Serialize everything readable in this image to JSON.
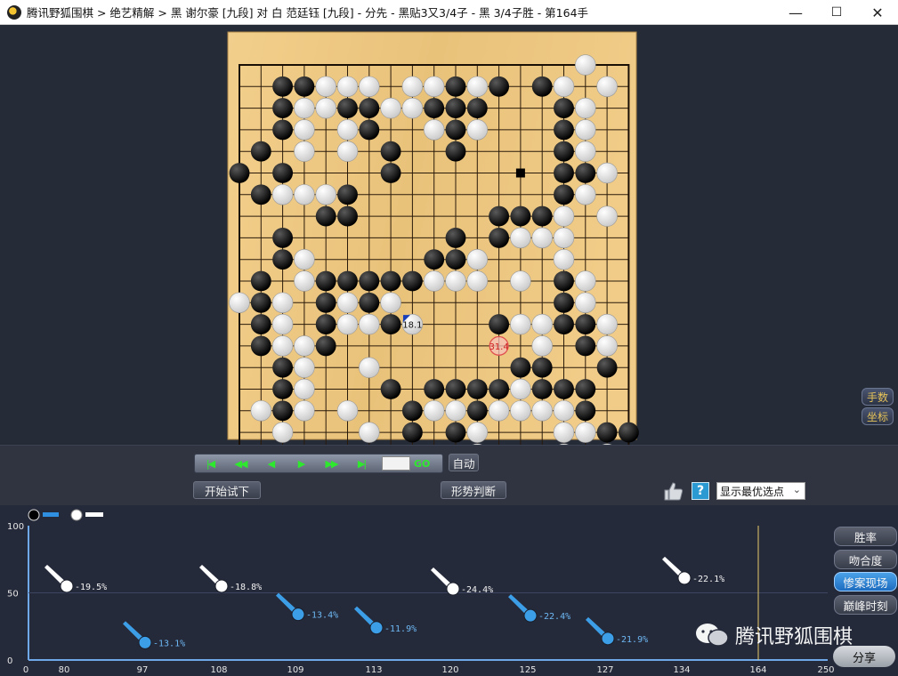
{
  "window": {
    "title": "腾讯野狐围棋 > 绝艺精解 > 黑 谢尔豪 [九段] 对 白 范廷钰 [九段] - 分先 - 黑贴3又3/4子 - 黑 3/4子胜 - 第164手",
    "minimize": "—",
    "maximize": "☐",
    "close": "✕"
  },
  "board": {
    "size": 19,
    "black": "IA,JA,NA,OA,RA,KB,LB,MB,NB,OB,RB,HC,MC,NC,RC,MD,LE,RE,SE,JF,RF,LG,LH,MH,IJ,JJ,NK,JK,KK,LK,MK,NK,PL,QL,RL,IL,JL,KL,NL,OL,PL,IN,KN,MN,ON,QN,RN,SN,IO,JO,QO,TO,JQ,RQ,IM,JM,KM",
    "white": "JB",
    "stones_black": [
      [
        2,
        1
      ],
      [
        3,
        1
      ],
      [
        10,
        1
      ],
      [
        12,
        1
      ],
      [
        14,
        1
      ],
      [
        2,
        2
      ],
      [
        5,
        2
      ],
      [
        6,
        2
      ],
      [
        9,
        2
      ],
      [
        10,
        2
      ],
      [
        11,
        2
      ],
      [
        15,
        2
      ],
      [
        2,
        3
      ],
      [
        6,
        3
      ],
      [
        10,
        3
      ],
      [
        15,
        3
      ],
      [
        1,
        4
      ],
      [
        7,
        4
      ],
      [
        10,
        4
      ],
      [
        15,
        4
      ],
      [
        0,
        5
      ],
      [
        2,
        5
      ],
      [
        7,
        5
      ],
      [
        15,
        5
      ],
      [
        16,
        5
      ],
      [
        1,
        6
      ],
      [
        5,
        6
      ],
      [
        15,
        6
      ],
      [
        4,
        7
      ],
      [
        5,
        7
      ],
      [
        12,
        7
      ],
      [
        13,
        7
      ],
      [
        14,
        7
      ],
      [
        2,
        8
      ],
      [
        10,
        8
      ],
      [
        12,
        8
      ],
      [
        2,
        9
      ],
      [
        9,
        9
      ],
      [
        10,
        9
      ],
      [
        1,
        10
      ],
      [
        4,
        10
      ],
      [
        5,
        10
      ],
      [
        6,
        10
      ],
      [
        7,
        10
      ],
      [
        8,
        10
      ],
      [
        15,
        10
      ],
      [
        1,
        11
      ],
      [
        4,
        11
      ],
      [
        6,
        11
      ],
      [
        15,
        11
      ],
      [
        1,
        12
      ],
      [
        4,
        12
      ],
      [
        7,
        12
      ],
      [
        12,
        12
      ],
      [
        15,
        12
      ],
      [
        16,
        12
      ],
      [
        1,
        13
      ],
      [
        4,
        13
      ],
      [
        16,
        13
      ],
      [
        2,
        14
      ],
      [
        13,
        14
      ],
      [
        14,
        14
      ],
      [
        17,
        14
      ],
      [
        2,
        15
      ],
      [
        7,
        15
      ],
      [
        9,
        15
      ],
      [
        10,
        15
      ],
      [
        11,
        15
      ],
      [
        12,
        15
      ],
      [
        14,
        15
      ],
      [
        15,
        15
      ],
      [
        16,
        15
      ],
      [
        2,
        16
      ],
      [
        8,
        16
      ],
      [
        11,
        16
      ],
      [
        16,
        16
      ],
      [
        8,
        17
      ],
      [
        10,
        17
      ],
      [
        17,
        17
      ],
      [
        18,
        17
      ]
    ],
    "stones_white": [
      [
        16,
        0
      ],
      [
        4,
        1
      ],
      [
        5,
        1
      ],
      [
        6,
        1
      ],
      [
        8,
        1
      ],
      [
        9,
        1
      ],
      [
        11,
        1
      ],
      [
        15,
        1
      ],
      [
        17,
        1
      ],
      [
        3,
        2
      ],
      [
        4,
        2
      ],
      [
        7,
        2
      ],
      [
        8,
        2
      ],
      [
        16,
        2
      ],
      [
        3,
        3
      ],
      [
        5,
        3
      ],
      [
        9,
        3
      ],
      [
        11,
        3
      ],
      [
        16,
        3
      ],
      [
        3,
        4
      ],
      [
        5,
        4
      ],
      [
        16,
        4
      ],
      [
        17,
        5
      ],
      [
        2,
        6
      ],
      [
        3,
        6
      ],
      [
        4,
        6
      ],
      [
        16,
        6
      ],
      [
        15,
        7
      ],
      [
        17,
        7
      ],
      [
        13,
        8
      ],
      [
        14,
        8
      ],
      [
        15,
        8
      ],
      [
        3,
        9
      ],
      [
        11,
        9
      ],
      [
        15,
        9
      ],
      [
        3,
        10
      ],
      [
        9,
        10
      ],
      [
        10,
        10
      ],
      [
        11,
        10
      ],
      [
        13,
        10
      ],
      [
        16,
        10
      ],
      [
        0,
        11
      ],
      [
        2,
        11
      ],
      [
        5,
        11
      ],
      [
        7,
        11
      ],
      [
        16,
        11
      ],
      [
        2,
        12
      ],
      [
        5,
        12
      ],
      [
        6,
        12
      ],
      [
        13,
        12
      ],
      [
        14,
        12
      ],
      [
        17,
        12
      ],
      [
        2,
        13
      ],
      [
        3,
        13
      ],
      [
        14,
        13
      ],
      [
        17,
        13
      ],
      [
        3,
        14
      ],
      [
        6,
        14
      ],
      [
        3,
        15
      ],
      [
        13,
        15
      ],
      [
        1,
        16
      ],
      [
        3,
        16
      ],
      [
        5,
        16
      ],
      [
        9,
        16
      ],
      [
        10,
        16
      ],
      [
        12,
        16
      ],
      [
        13,
        16
      ],
      [
        14,
        16
      ],
      [
        15,
        16
      ],
      [
        2,
        17
      ],
      [
        6,
        17
      ],
      [
        11,
        17
      ],
      [
        15,
        17
      ],
      [
        16,
        17
      ],
      [
        11,
        18
      ],
      [
        15,
        18
      ],
      [
        17,
        18
      ]
    ],
    "last_move": [
      8,
      12
    ],
    "hint_move": [
      12,
      13
    ],
    "hint_label": "31.4",
    "last_move_label": "18.1",
    "square_marker": [
      13,
      5
    ]
  },
  "side_buttons": {
    "moves": "手数",
    "coords": "坐标"
  },
  "controls": {
    "first": "|◀",
    "back10": "◀◀",
    "back": "◀",
    "forward": "▶",
    "forward10": "▶▶",
    "last": "▶|",
    "go": "GO",
    "auto": "自动",
    "try_play": "开始试下",
    "judge": "形势判断",
    "help": "?",
    "option": "显示最优选点",
    "option_chevron": "⌄"
  },
  "chart_data": {
    "type": "scatter",
    "ylim": [
      0,
      100
    ],
    "yticks": [
      "100",
      "50",
      "0"
    ],
    "xtick_labels": [
      "0",
      "80",
      "97",
      "108",
      "109",
      "113",
      "120",
      "125",
      "127",
      "134",
      "164",
      "250"
    ],
    "current_move_label": "164",
    "points": [
      {
        "label": "-19.5%",
        "color": "white",
        "tick": 1,
        "y": 55
      },
      {
        "label": "-13.1%",
        "color": "blue",
        "tick": 2,
        "y": 13
      },
      {
        "label": "-18.8%",
        "color": "white",
        "tick": 3,
        "y": 55
      },
      {
        "label": "-13.4%",
        "color": "blue",
        "tick": 4,
        "y": 34
      },
      {
        "label": "-11.9%",
        "color": "blue",
        "tick": 5,
        "y": 24
      },
      {
        "label": "-24.4%",
        "color": "white",
        "tick": 6,
        "y": 53
      },
      {
        "label": "-22.4%",
        "color": "blue",
        "tick": 7,
        "y": 33
      },
      {
        "label": "-21.9%",
        "color": "blue",
        "tick": 8,
        "y": 16
      },
      {
        "label": "-22.1%",
        "color": "white",
        "tick": 9,
        "y": 61
      }
    ]
  },
  "analysis_buttons": {
    "win_rate": "胜率",
    "match": "吻合度",
    "disaster": "惨案现场",
    "peak": "巅峰时刻"
  },
  "watermark": "腾讯野狐围棋",
  "share": "分享",
  "colors": {
    "board": "#e8c37a",
    "accent": "#2f8fe0",
    "blue_marker": "#3d9ee8"
  }
}
